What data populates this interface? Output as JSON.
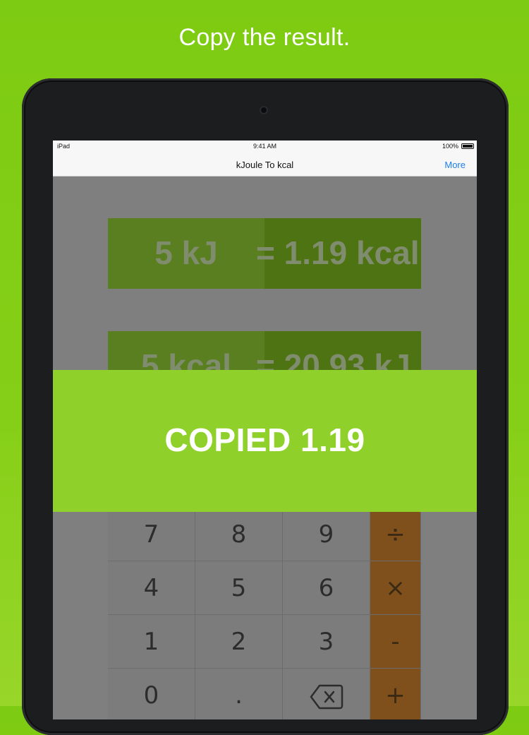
{
  "headline": "Copy the result.",
  "statusbar": {
    "carrier": "iPad",
    "time": "9:41 AM",
    "battery": "100%"
  },
  "navbar": {
    "title": "kJoule To kcal",
    "more": "More"
  },
  "conversions": [
    {
      "lhs_value": "5",
      "lhs_unit": "kJ",
      "rhs_value": "= 1.19",
      "rhs_unit": "kcal"
    },
    {
      "lhs_value": "5",
      "lhs_unit": "kcal",
      "rhs_value": "= 20.93",
      "rhs_unit": "kJ"
    }
  ],
  "keypad": {
    "rows": [
      [
        "7",
        "8",
        "9",
        "÷"
      ],
      [
        "4",
        "5",
        "6",
        "×"
      ],
      [
        "1",
        "2",
        "3",
        "-"
      ],
      [
        "0",
        ".",
        "⌫",
        "+"
      ]
    ]
  },
  "toast": {
    "message": "COPIED 1.19"
  },
  "colors": {
    "background": "#7dcb12",
    "toast": "#8fd12a",
    "operator": "#80501c",
    "link": "#1a7ff0"
  }
}
